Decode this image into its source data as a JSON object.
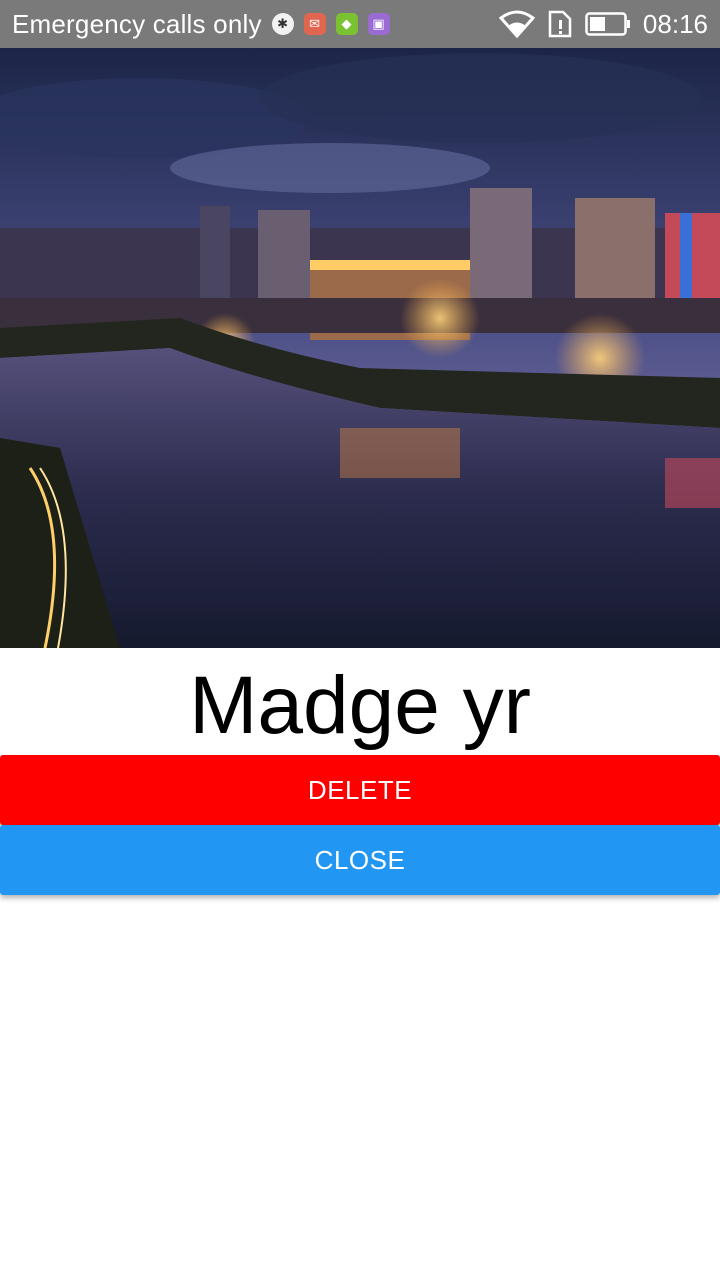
{
  "status_bar": {
    "carrier_text": "Emergency calls only",
    "time": "08:16",
    "notification_icons": [
      "bug-icon",
      "mail-icon",
      "shield-icon",
      "image-icon"
    ],
    "system_icons": [
      "wifi-icon",
      "sim-alert-icon",
      "battery-icon"
    ]
  },
  "content": {
    "image_icon": "city-night-photo",
    "title": "Madge yr"
  },
  "buttons": {
    "delete_label": "DELETE",
    "close_label": "CLOSE"
  },
  "colors": {
    "status_bar_bg": "#7a7a7a",
    "delete_bg": "#ff0000",
    "close_bg": "#2196f3"
  }
}
